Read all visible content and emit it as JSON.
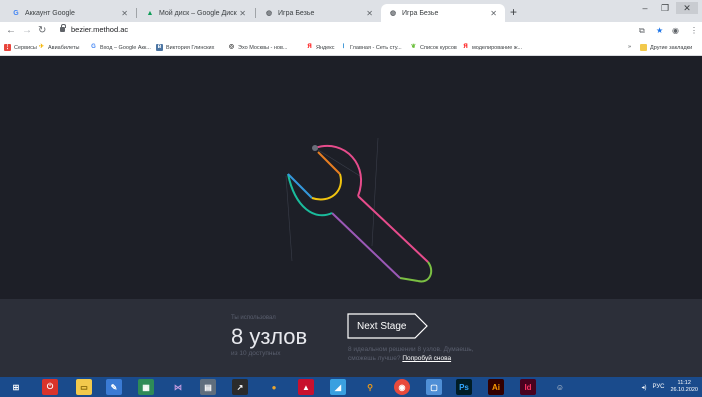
{
  "browser": {
    "tabs": [
      {
        "label": "Аккаунт Google",
        "icon": "google-icon"
      },
      {
        "label": "Мой диск – Google Диск",
        "icon": "drive-icon"
      },
      {
        "label": "Игра Безье",
        "icon": "globe-icon"
      },
      {
        "label": "Игра Безье",
        "icon": "globe-icon"
      }
    ],
    "new_tab": "+",
    "url": "bezier.method.ac",
    "bookmarks": [
      {
        "label": "Сервисы",
        "icon": "apps-icon",
        "color": "#e8453c"
      },
      {
        "label": "Авиабилеты",
        "icon": "plane-icon",
        "color": "#f4b400"
      },
      {
        "label": "Вход – Google Акк...",
        "icon": "google-icon",
        "color": "#4285f4"
      },
      {
        "label": "Виктория Глинских",
        "icon": "vk-icon",
        "color": "#4c75a3"
      },
      {
        "label": "Эхо Москвы - нов...",
        "icon": "echo-icon",
        "color": "#333333"
      },
      {
        "label": "Яндекс",
        "icon": "yandex-icon",
        "color": "#ff0000"
      },
      {
        "label": "Главная - Сеть сту...",
        "icon": "network-icon",
        "color": "#2a8cd2"
      },
      {
        "label": "Список курсов",
        "icon": "leaf-icon",
        "color": "#6bbf3b"
      },
      {
        "label": "моделирование ж...",
        "icon": "yandex-icon",
        "color": "#ff0000"
      }
    ],
    "bookmarks_more": "»",
    "other_bookmarks": "Другие закладки"
  },
  "game": {
    "used_label": "Ты использовал",
    "nodes_count": "8 узлов",
    "available": "из 10 доступных",
    "next_button": "Next Stage",
    "hint_text": "8 идеальном решении 8 узлов. Думаешь, сможешь лучше?",
    "retry_link": "Попробуй снова"
  },
  "taskbar": {
    "items": [
      {
        "icon": "windows-start-icon",
        "color": "#1a4b8c"
      },
      {
        "icon": "power-icon",
        "color": "#d9342b"
      },
      {
        "icon": "folder-icon",
        "color": "#f2c94c"
      },
      {
        "icon": "notebook-icon",
        "color": "#3a7bd5"
      },
      {
        "icon": "spreadsheet-icon",
        "color": "#2e8b57"
      },
      {
        "icon": "bow-icon",
        "color": "#8a4fbf"
      },
      {
        "icon": "calculator-icon",
        "color": "#5f6e7d"
      },
      {
        "icon": "chart-icon",
        "color": "#2b2b2b"
      },
      {
        "icon": "paint-icon",
        "color": "#e8a531"
      },
      {
        "icon": "acrobat-icon",
        "color": "#c8102e"
      },
      {
        "icon": "triangle-app-icon",
        "color": "#3aa0e0"
      },
      {
        "icon": "search-icon",
        "color": "#f39c12"
      },
      {
        "icon": "chrome-icon",
        "color": "#e84a3c"
      },
      {
        "icon": "window-icon",
        "color": "#4f8fd6"
      },
      {
        "icon": "photoshop-icon",
        "label": "Ps",
        "color": "#001d26"
      },
      {
        "icon": "illustrator-icon",
        "label": "Ai",
        "color": "#330000"
      },
      {
        "icon": "indesign-icon",
        "label": "Id",
        "color": "#49021f"
      },
      {
        "icon": "gamepad-icon",
        "color": "#2f2f2f"
      }
    ],
    "lang": "РУС",
    "time": "11:12",
    "date": "26.10.2020"
  }
}
